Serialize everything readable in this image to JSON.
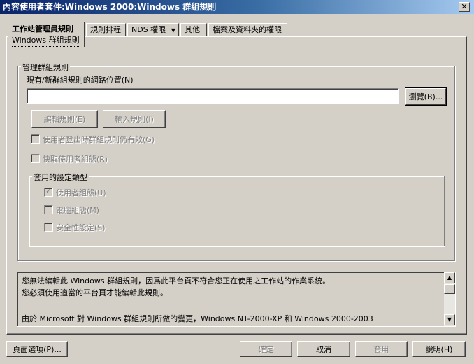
{
  "window": {
    "title": "內容使用者套件:Windows 2000:Windows 群組規則",
    "close_glyph": "✕"
  },
  "tabs": [
    {
      "label": "工作站管理員規則",
      "sublabel": "Windows 群組規則",
      "active": true
    },
    {
      "label": "規則排程"
    },
    {
      "label": "NDS 權限",
      "dropdown_glyph": "▼"
    },
    {
      "label": "其他"
    },
    {
      "label": "檔案及資料夾的權限"
    }
  ],
  "group_policy": {
    "legend": "管理群組規則",
    "location_label": "現有/新群組規則的網路位置(N)",
    "location_value": "",
    "browse_button": "瀏覽(B)...",
    "edit_button": "編輯規則(E)",
    "import_button": "輸入規則(I)",
    "checkbox_logout": "使用者登出時群組規則仍有效(G)",
    "checkbox_cache": "快取使用者組態(R)",
    "settings_type": {
      "legend": "套用的設定類型",
      "items": [
        {
          "label": "使用者組態(U)",
          "checked": true
        },
        {
          "label": "電腦組態(M)",
          "checked": false
        },
        {
          "label": "安全性設定(S)",
          "checked": false
        }
      ]
    }
  },
  "info": {
    "lines": [
      "您無法編輯此 Windows 群組規則，因爲此平台頁不符合您正在使用之工作站的作業系統。",
      "您必須使用適當的平台頁才能編輯此規則。",
      "",
      "由於 Microsoft 對 Windows 群組規則所做的變更，Windows NT-2000-XP 和 Windows 2000-2003"
    ],
    "scroll_up_glyph": "▲",
    "scroll_down_glyph": "▼"
  },
  "footer": {
    "page_options": "頁面選項(P)...",
    "ok": "確定",
    "cancel": "取消",
    "apply": "套用",
    "help": "說明(H)"
  },
  "check_glyph": "✓"
}
